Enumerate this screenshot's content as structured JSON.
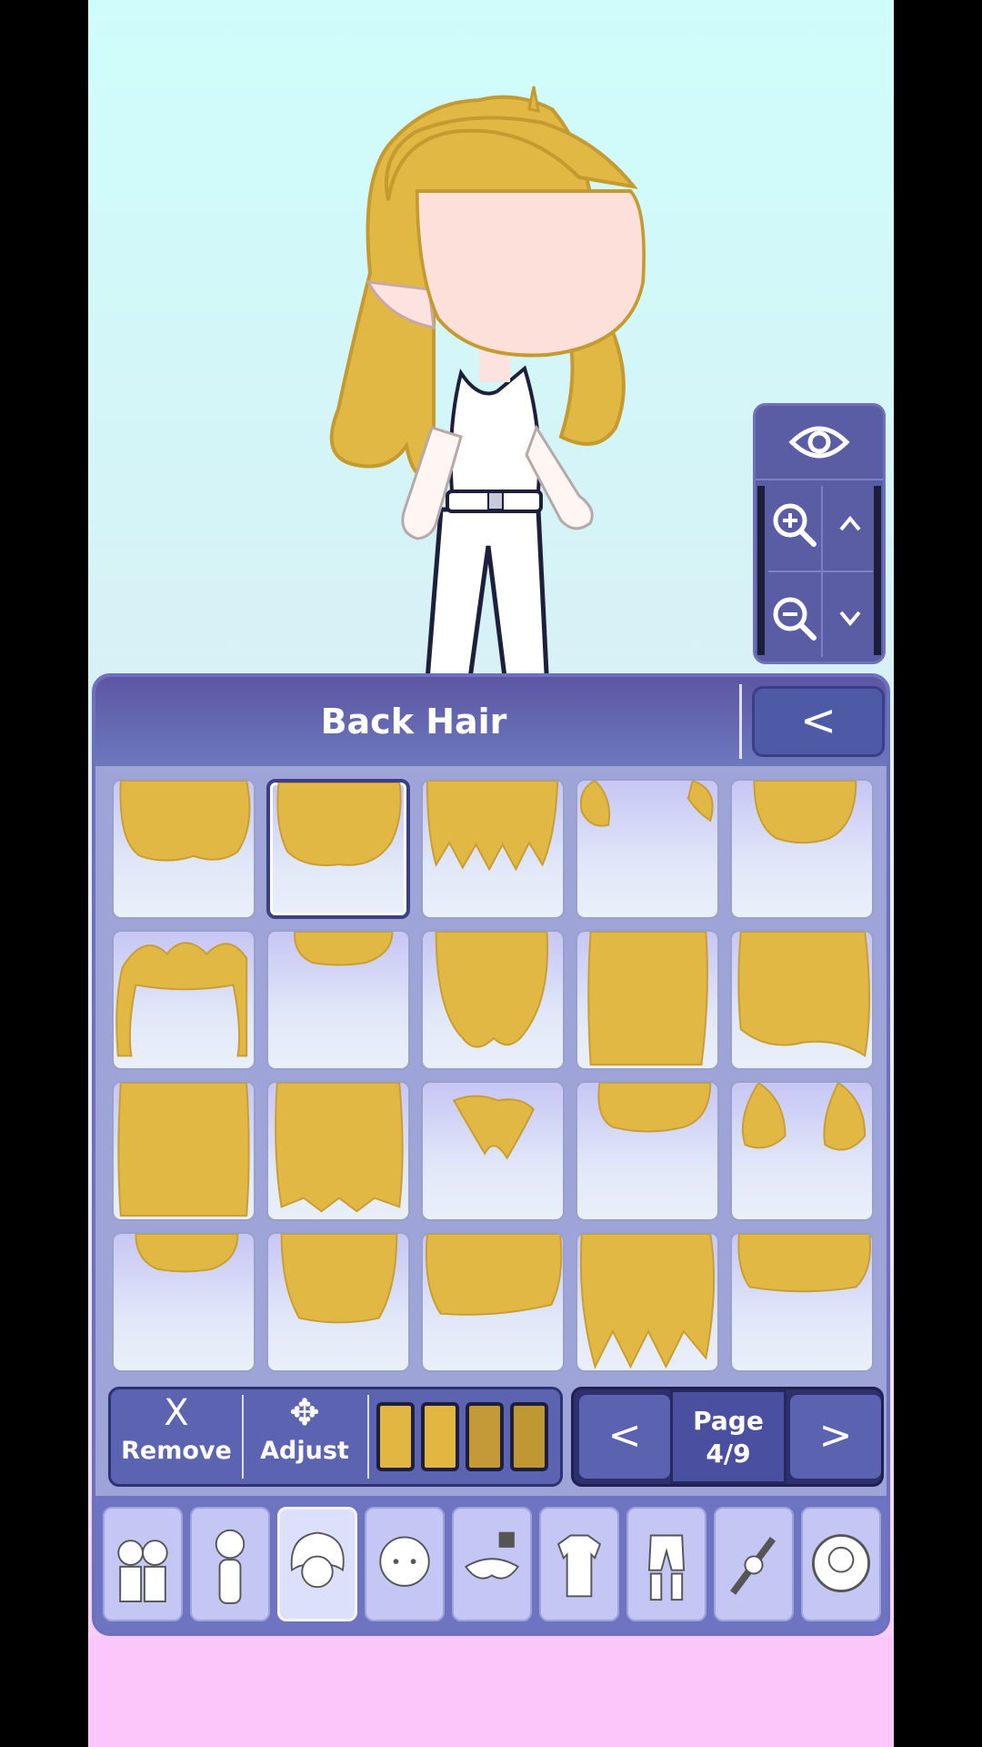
{
  "panel": {
    "title": "Back Hair",
    "back_label": "<"
  },
  "tools": {
    "remove_icon": "X",
    "remove_label": "Remove",
    "adjust_icon": "✥",
    "adjust_label": "Adjust",
    "swatches": [
      "#e0b743",
      "#e1b741",
      "#c39a37",
      "#bf9834"
    ]
  },
  "pager": {
    "prev_label": "<",
    "next_label": ">",
    "page_label": "Page",
    "page_value": "4/9"
  },
  "hair_color": "#e1b843",
  "selected_item_index": 1,
  "categories": [
    "presets-icon",
    "body-icon",
    "hair-icon",
    "face-icon",
    "accessories-icon",
    "top-clothing-icon",
    "bottom-clothing-icon",
    "items-icon",
    "profile-icon"
  ],
  "active_category_index": 2
}
